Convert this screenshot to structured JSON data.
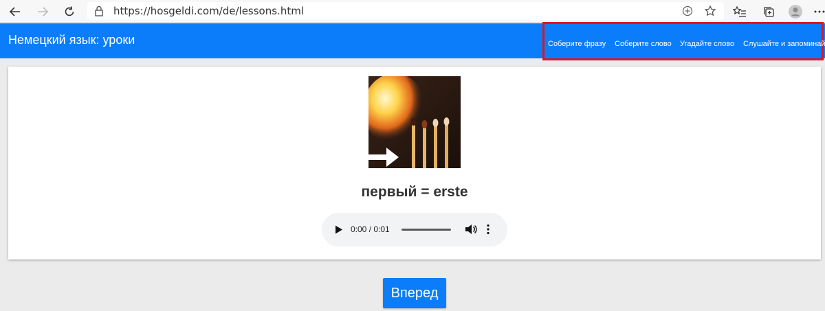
{
  "browser": {
    "url": "https://hosgeldi.com/de/lessons.html"
  },
  "header": {
    "title": "Немецкий язык: уроки",
    "nav": [
      {
        "label": "Соберите фразу"
      },
      {
        "label": "Соберите слово"
      },
      {
        "label": "Угадайте слово"
      },
      {
        "label": "Слушайте и запоминай"
      }
    ]
  },
  "lesson": {
    "word": "первый = erste",
    "image_icon": "burning-matches-image"
  },
  "audio": {
    "time": "0:00 / 0:01",
    "progress": 0
  },
  "footer": {
    "next_label": "Вперед"
  },
  "colors": {
    "brand_blue": "#0b7dfb",
    "highlight_red": "#e0141e"
  }
}
